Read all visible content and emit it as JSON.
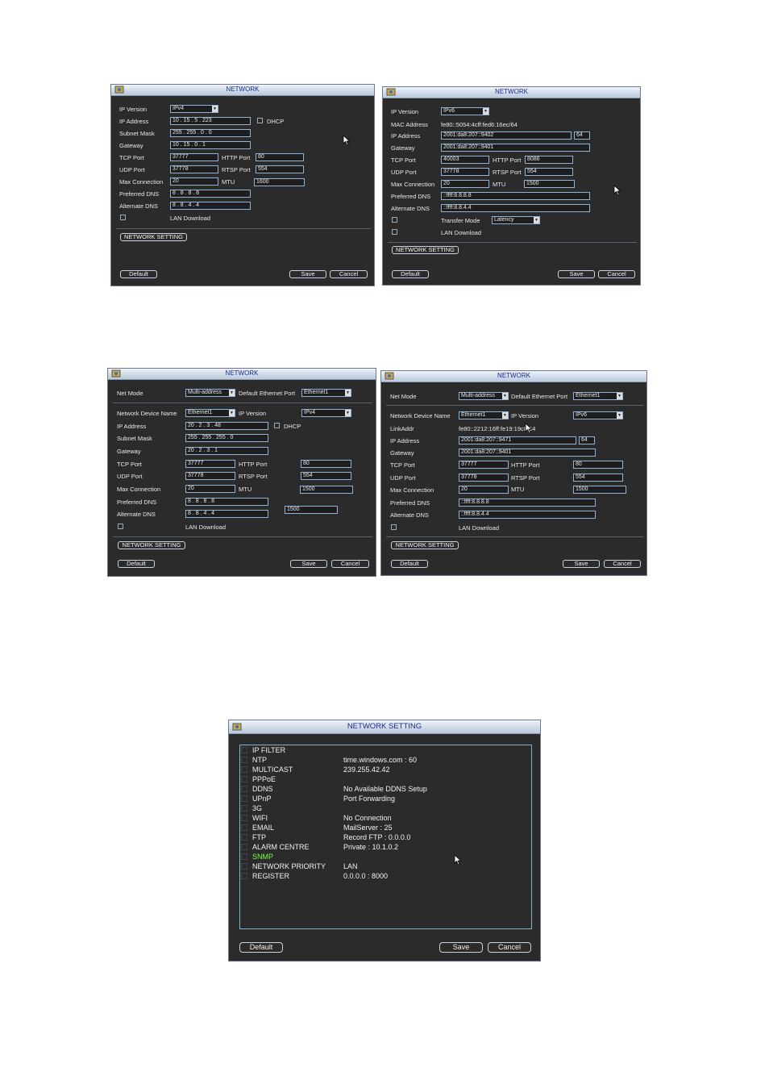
{
  "w1": {
    "title": "NETWORK",
    "labels": {
      "ipver": "IP Version",
      "ip": "IP Address",
      "mask": "Subnet Mask",
      "gw": "Gateway",
      "tcp": "TCP Port",
      "udp": "UDP Port",
      "maxc": "Max Connection",
      "pdns": "Preferred DNS",
      "adns": "Alternate DNS",
      "lan": "LAN Download",
      "dhcp": "DHCP",
      "http": "HTTP Port",
      "rtsp": "RTSP Port",
      "mtu": "MTU"
    },
    "values": {
      "ipver": "IPv4",
      "ip": "10  .  15  .  5  .  223",
      "mask": "255 . 255 .  0  .  0",
      "gw": "10  .  15  .  0  .  1",
      "tcp": "37777",
      "udp": "37778",
      "maxc": "20",
      "pdns": "8  .  8  .  8  .  8",
      "adns": "8  .  8  .  4  .  4",
      "http": "80",
      "rtsp": "554",
      "mtu": "1600"
    },
    "buttons": {
      "setting": "NETWORK SETTING",
      "default": "Default",
      "save": "Save",
      "cancel": "Cancel"
    }
  },
  "w2": {
    "title": "NETWORK",
    "labels": {
      "ipver": "IP Version",
      "mac": "MAC Address",
      "ip": "IP Address",
      "gw": "Gateway",
      "tcp": "TCP Port",
      "udp": "UDP Port",
      "maxc": "Max Connection",
      "pdns": "Preferred DNS",
      "adns": "Alternate DNS",
      "transfer": "Transfer Mode",
      "lan": "LAN Download",
      "http": "HTTP Port",
      "rtsp": "RTSP Port",
      "mtu": "MTU"
    },
    "values": {
      "ipver": "IPv6",
      "mac": "fe80::5054:4cff:fed6:16ec/64",
      "ip": "2001:da8:207::9402",
      "prefix": "64",
      "gw": "2001:da8:207::9401",
      "tcp": "40003",
      "udp": "37778",
      "maxc": "20",
      "pdns": "::ffff:8.8.8.8",
      "adns": "::ffff:8.8.4.4",
      "transfer": "Latency",
      "http": "8086",
      "rtsp": "554",
      "mtu": "1500"
    },
    "buttons": {
      "setting": "NETWORK SETTING",
      "default": "Default",
      "save": "Save",
      "cancel": "Cancel"
    }
  },
  "w3": {
    "title": "NETWORK",
    "labels": {
      "netmode": "Net Mode",
      "defport": "Default Ethernet Port",
      "devname": "Network Device Name",
      "ipver": "IP Version",
      "ip": "IP Address",
      "mask": "Subnet Mask",
      "gw": "Gateway",
      "tcp": "TCP Port",
      "udp": "UDP Port",
      "maxc": "Max Connection",
      "pdns": "Preferred DNS",
      "adns": "Alternate DNS",
      "lan": "LAN Download",
      "dhcp": "DHCP",
      "http": "HTTP Port",
      "rtsp": "RTSP Port",
      "mtu": "MTU"
    },
    "values": {
      "netmode": "Multi-address",
      "defport": "Ethernet1",
      "devname": "Ethernet1",
      "ipver": "IPv4",
      "ip": "20  .  2  .  3  .  48",
      "mask": "255 . 255 . 255 .  0",
      "gw": "20  .  2  .  3  .  1",
      "tcp": "37777",
      "udp": "37778",
      "maxc": "20",
      "pdns": "8  .  8  .  8  .  8",
      "adns": "8  .  8  .  4  .  4",
      "http": "80",
      "rtsp": "554",
      "mtu": "1500",
      "extra": "1500"
    },
    "buttons": {
      "setting": "NETWORK SETTING",
      "default": "Default",
      "save": "Save",
      "cancel": "Cancel"
    }
  },
  "w4": {
    "title": "NETWORK",
    "labels": {
      "netmode": "Net Mode",
      "defport": "Default Ethernet Port",
      "devname": "Network Device Name",
      "ipver": "IP Version",
      "link": "LinkAddr",
      "ip": "IP Address",
      "gw": "Gateway",
      "tcp": "TCP Port",
      "udp": "UDP Port",
      "maxc": "Max Connection",
      "pdns": "Preferred DNS",
      "adns": "Alternate DNS",
      "lan": "LAN Download",
      "http": "HTTP Port",
      "rtsp": "RTSP Port",
      "mtu": "MTU"
    },
    "values": {
      "netmode": "Multi-address",
      "defport": "Ethernet1",
      "devname": "Ethernet1",
      "ipver": "IPv6",
      "link": "fe80::2212:16ff:fe19:19c8/64",
      "ip": "2001:da8:207::9471",
      "prefix": "64",
      "gw": "2001:da8:207::9401",
      "tcp": "37777",
      "udp": "37778",
      "maxc": "20",
      "pdns": "::ffff:8.8.8.8",
      "adns": "::ffff:8.8.4.4",
      "http": "80",
      "rtsp": "554",
      "mtu": "1500"
    },
    "buttons": {
      "setting": "NETWORK SETTING",
      "default": "Default",
      "save": "Save",
      "cancel": "Cancel"
    }
  },
  "w5": {
    "title": "NETWORK SETTING",
    "items": [
      {
        "name": "IP FILTER",
        "value": ""
      },
      {
        "name": "NTP",
        "value": "time.windows.com : 60"
      },
      {
        "name": "MULTICAST",
        "value": "239.255.42.42"
      },
      {
        "name": "PPPoE",
        "value": ""
      },
      {
        "name": "DDNS",
        "value": "No Available DDNS Setup"
      },
      {
        "name": "UPnP",
        "value": "Port Forwarding"
      },
      {
        "name": "3G",
        "value": ""
      },
      {
        "name": "WIFI",
        "value": "No Connection"
      },
      {
        "name": "EMAIL",
        "value": "MailServer : 25"
      },
      {
        "name": "FTP",
        "value": "Record FTP : 0.0.0.0"
      },
      {
        "name": "ALARM CENTRE",
        "value": "Private : 10.1.0.2"
      },
      {
        "name": "SNMP",
        "value": ""
      },
      {
        "name": "NETWORK PRIORITY",
        "value": "LAN"
      },
      {
        "name": "REGISTER",
        "value": "0.0.0.0 : 8000"
      }
    ],
    "highlight_color": "#7cff3a",
    "buttons": {
      "default": "Default",
      "save": "Save",
      "cancel": "Cancel"
    }
  }
}
